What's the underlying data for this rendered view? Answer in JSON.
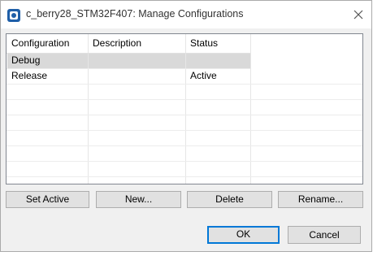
{
  "window": {
    "title": "c_berry28_STM32F407: Manage Configurations",
    "app_icon": "app-logo-icon",
    "close_icon": "close-icon"
  },
  "table": {
    "columns": [
      "Configuration",
      "Description",
      "Status"
    ],
    "rows": [
      {
        "configuration": "Debug",
        "description": "",
        "status": "",
        "selected": true
      },
      {
        "configuration": "Release",
        "description": "",
        "status": "Active",
        "selected": false
      }
    ]
  },
  "actions": {
    "set_active": "Set Active",
    "new": "New...",
    "delete": "Delete",
    "rename": "Rename..."
  },
  "footer": {
    "ok": "OK",
    "cancel": "Cancel"
  },
  "colors": {
    "selection": "#d9d9d9",
    "default_button_border": "#0078d7",
    "button_face": "#e1e1e1",
    "dialog_bg": "#f0f0f0"
  }
}
